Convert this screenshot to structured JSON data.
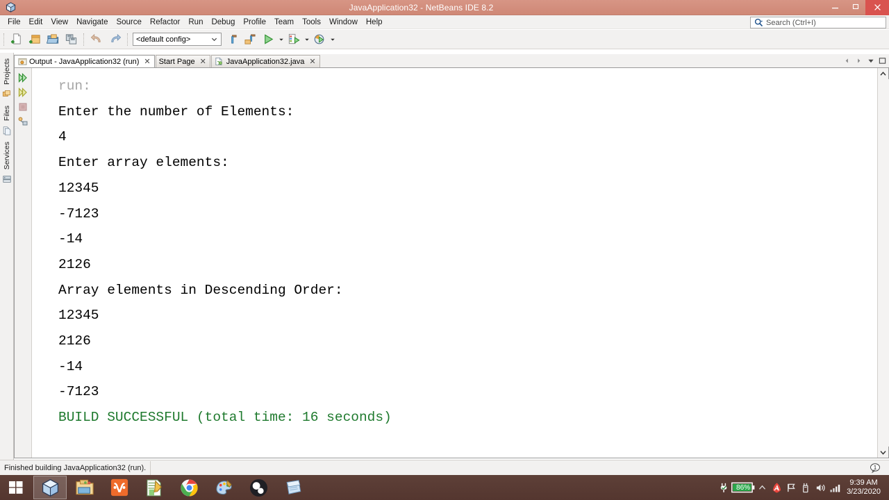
{
  "window": {
    "title": "JavaApplication32 - NetBeans IDE 8.2",
    "app_icon": "netbeans-cube-icon",
    "minimize_label": "–",
    "maximize_label": "❐",
    "close_label": "✕"
  },
  "menubar": {
    "items": [
      {
        "label": "File"
      },
      {
        "label": "Edit"
      },
      {
        "label": "View"
      },
      {
        "label": "Navigate"
      },
      {
        "label": "Source"
      },
      {
        "label": "Refactor"
      },
      {
        "label": "Run"
      },
      {
        "label": "Debug"
      },
      {
        "label": "Profile"
      },
      {
        "label": "Team"
      },
      {
        "label": "Tools"
      },
      {
        "label": "Window"
      },
      {
        "label": "Help"
      }
    ],
    "search": {
      "placeholder": "Search (Ctrl+I)",
      "value": "",
      "icon": "search-icon"
    }
  },
  "toolbar": {
    "config_value": "<default config>",
    "buttons": [
      {
        "name": "new-file-button"
      },
      {
        "name": "new-project-button"
      },
      {
        "name": "open-project-button"
      },
      {
        "name": "save-all-button"
      },
      {
        "name": "undo-button"
      },
      {
        "name": "redo-button"
      },
      {
        "name": "build-project-button"
      },
      {
        "name": "clean-and-build-button"
      },
      {
        "name": "run-project-button"
      },
      {
        "name": "debug-project-button"
      },
      {
        "name": "profile-project-button"
      }
    ]
  },
  "left_dock": {
    "items": [
      {
        "label": "Projects",
        "icon": "projects-icon"
      },
      {
        "label": "Files",
        "icon": "files-icon"
      },
      {
        "label": "Services",
        "icon": "services-icon"
      }
    ]
  },
  "tabs": {
    "items": [
      {
        "label": "Output - JavaApplication32 (run)",
        "icon": "output-icon",
        "active": true,
        "close": "✕"
      },
      {
        "label": "Start Page",
        "icon": "",
        "active": false,
        "close": "✕"
      },
      {
        "label": "JavaApplication32.java",
        "icon": "java-file-icon",
        "active": false,
        "close": "✕"
      }
    ],
    "controls": {
      "scroll_left": "◀",
      "scroll_right": "▶",
      "dropdown": "▼",
      "maximize": "❐"
    }
  },
  "output": {
    "gutter_buttons": [
      {
        "name": "rerun-button"
      },
      {
        "name": "rerun-with-arguments-button"
      },
      {
        "name": "stop-button"
      },
      {
        "name": "output-settings-button"
      }
    ],
    "lines": [
      {
        "text": "run:",
        "style": "dim"
      },
      {
        "text": "Enter the number of Elements:",
        "style": "normal"
      },
      {
        "text": "4",
        "style": "normal"
      },
      {
        "text": "Enter array elements:",
        "style": "normal"
      },
      {
        "text": "12345",
        "style": "normal"
      },
      {
        "text": "-7123",
        "style": "normal"
      },
      {
        "text": "-14",
        "style": "normal"
      },
      {
        "text": "2126",
        "style": "normal"
      },
      {
        "text": "Array elements in Descending Order:",
        "style": "normal"
      },
      {
        "text": "12345",
        "style": "normal"
      },
      {
        "text": "2126",
        "style": "normal"
      },
      {
        "text": "-14",
        "style": "normal"
      },
      {
        "text": "-7123",
        "style": "normal"
      },
      {
        "text": "BUILD SUCCESSFUL (total time: 16 seconds)",
        "style": "green"
      }
    ],
    "scrollbar": {
      "up": "▲",
      "down": "▼"
    }
  },
  "statusbar": {
    "message": "Finished building JavaApplication32 (run).",
    "notification_count": "1"
  },
  "taskbar": {
    "start": {
      "name": "windows-start-button"
    },
    "apps": [
      {
        "name": "netbeans-taskbar-icon",
        "active": true
      },
      {
        "name": "file-explorer-taskbar-icon",
        "active": false
      },
      {
        "name": "xampp-taskbar-icon",
        "active": false
      },
      {
        "name": "notepadpp-taskbar-icon",
        "active": false
      },
      {
        "name": "chrome-taskbar-icon",
        "active": false
      },
      {
        "name": "paint-taskbar-icon",
        "active": false
      },
      {
        "name": "obs-taskbar-icon",
        "active": false
      },
      {
        "name": "sticky-notes-taskbar-icon",
        "active": false
      }
    ],
    "tray": {
      "show_hidden": "▲",
      "battery_percent": "86%",
      "time": "9:39 AM",
      "date": "3/23/2020"
    }
  },
  "colors": {
    "titlebar": "#d08a78",
    "taskbar": "#58382f",
    "accent_green": "#1f7a2e",
    "dim_text": "#a6a6a6",
    "battery_green": "#2aa84a"
  }
}
